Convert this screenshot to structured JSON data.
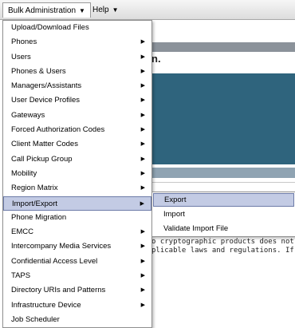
{
  "menubar": {
    "bulk_admin": "Bulk Administration",
    "help": "Help"
  },
  "background": {
    "title_fragment": "n.",
    "notice_line1": "o cryptographic products does not imply",
    "notice_line2": "plicable laws and regulations. If you are"
  },
  "dropdown": {
    "items": [
      {
        "label": "Upload/Download Files",
        "submenu": false
      },
      {
        "label": "Phones",
        "submenu": true
      },
      {
        "label": "Users",
        "submenu": true
      },
      {
        "label": "Phones & Users",
        "submenu": true
      },
      {
        "label": "Managers/Assistants",
        "submenu": true
      },
      {
        "label": "User Device Profiles",
        "submenu": true
      },
      {
        "label": "Gateways",
        "submenu": true
      },
      {
        "label": "Forced Authorization Codes",
        "submenu": true
      },
      {
        "label": "Client Matter Codes",
        "submenu": true
      },
      {
        "label": "Call Pickup Group",
        "submenu": true
      },
      {
        "label": "Mobility",
        "submenu": true
      },
      {
        "label": "Region Matrix",
        "submenu": true
      },
      {
        "label": "Import/Export",
        "submenu": true,
        "selected": true
      },
      {
        "label": "Phone Migration",
        "submenu": false
      },
      {
        "label": "EMCC",
        "submenu": true
      },
      {
        "label": "Intercompany Media Services",
        "submenu": true
      },
      {
        "label": "Confidential Access Level",
        "submenu": true
      },
      {
        "label": "TAPS",
        "submenu": true
      },
      {
        "label": "Directory URIs and Patterns",
        "submenu": true
      },
      {
        "label": "Infrastructure Device",
        "submenu": true
      },
      {
        "label": "Job Scheduler",
        "submenu": false
      }
    ]
  },
  "submenu": {
    "items": [
      {
        "label": "Export",
        "selected": true
      },
      {
        "label": "Import"
      },
      {
        "label": "Validate Import File"
      }
    ]
  }
}
